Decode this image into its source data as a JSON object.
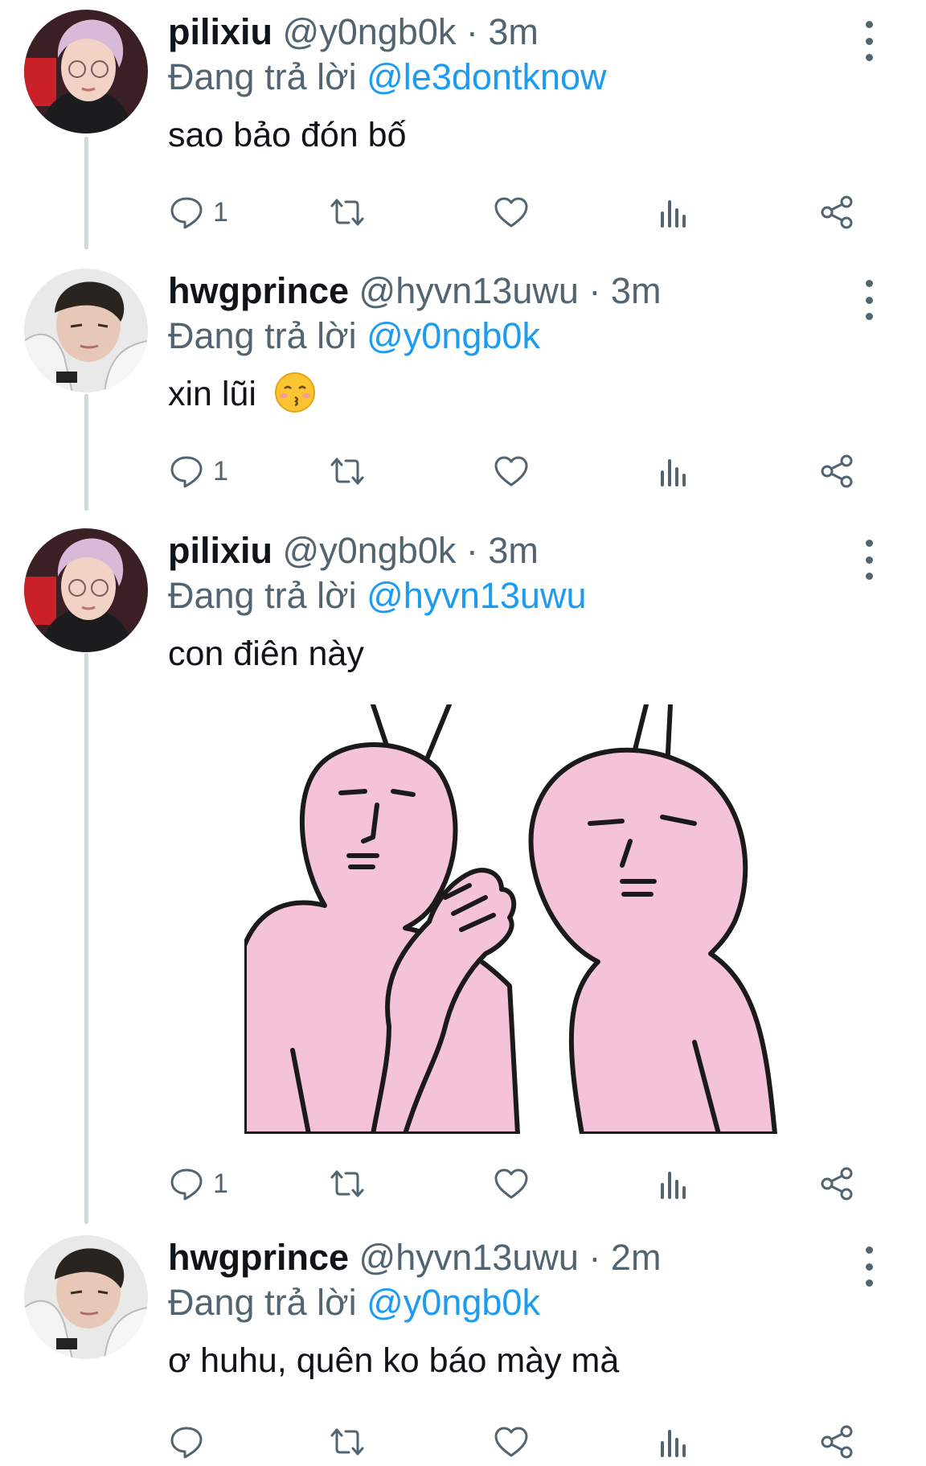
{
  "tweets": [
    {
      "display_name": "pilixiu",
      "handle": "@y0ngb0k",
      "separator": "·",
      "time": "3m",
      "reply_prefix": "Đang trả lời",
      "reply_to": "@le3dontknow",
      "text": "sao bảo đón bố",
      "reply_count": "1",
      "avatar": "pink-hair-avatar"
    },
    {
      "display_name": "hwgprince",
      "handle": "@hyvn13uwu",
      "separator": "·",
      "time": "3m",
      "reply_prefix": "Đang trả lời",
      "reply_to": "@y0ngb0k",
      "text": "xin lũi",
      "emoji": "kissing-face-closed-eyes-emoji",
      "reply_count": "1",
      "avatar": "hoodie-avatar"
    },
    {
      "display_name": "pilixiu",
      "handle": "@y0ngb0k",
      "separator": "·",
      "time": "3m",
      "reply_prefix": "Đang trả lời",
      "reply_to": "@hyvn13uwu",
      "text": "con điên này",
      "media": "two-pink-rabbits-whispering-sticker",
      "reply_count": "1",
      "avatar": "pink-hair-avatar"
    },
    {
      "display_name": "hwgprince",
      "handle": "@hyvn13uwu",
      "separator": "·",
      "time": "2m",
      "reply_prefix": "Đang trả lời",
      "reply_to": "@y0ngb0k",
      "text": "ơ huhu, quên ko báo mày mà",
      "reply_count": "",
      "avatar": "hoodie-avatar"
    }
  ],
  "icons": [
    "reply-icon",
    "retweet-icon",
    "like-icon",
    "views-icon",
    "share-icon",
    "more-icon"
  ],
  "colors": {
    "name": "#0f1419",
    "muted": "#536471",
    "link": "#1d9bf0",
    "thread_line": "#cfd9de",
    "sticker_pink": "#f5c3d8"
  }
}
